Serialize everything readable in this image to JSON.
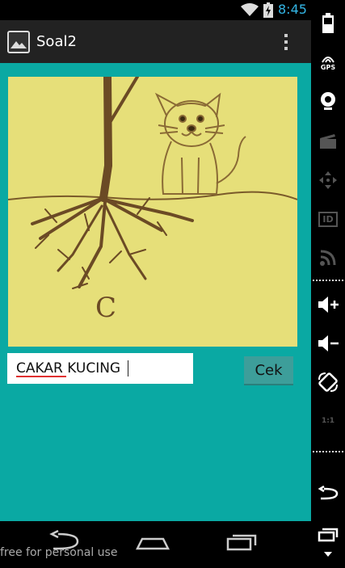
{
  "status_bar": {
    "time": "8:45"
  },
  "action_bar": {
    "title": "Soal2"
  },
  "question": {
    "answer_value": "CAKAR KUCING",
    "check_label": "Cek",
    "picture_letter": "C"
  },
  "watermark": "free for personal use",
  "emulator_toolbar": {
    "gps_label": "GPS",
    "id_label": "ID",
    "ratio_label": "1:1"
  },
  "colors": {
    "content_background": "#0aa9a3",
    "picture_background": "#e6df79",
    "tree_brown": "#6b4a25",
    "clock_blue": "#33b5e5",
    "button_teal": "#3d9e9a"
  }
}
